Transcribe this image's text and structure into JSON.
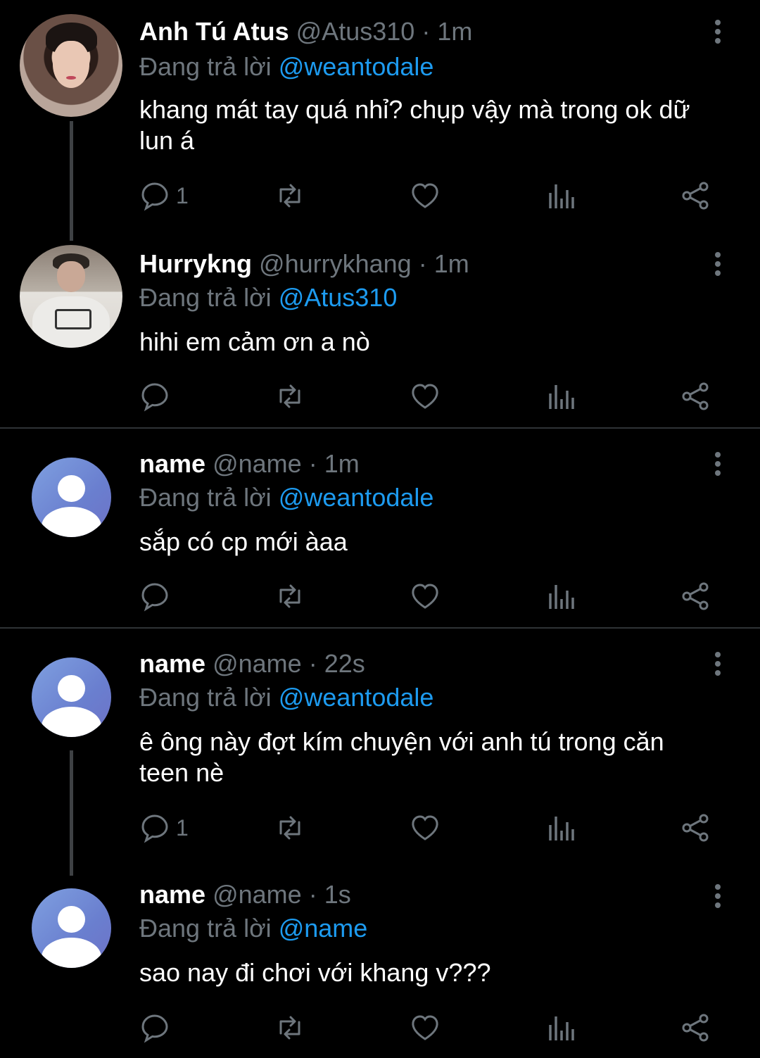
{
  "reply_prefix": "Đang trả lời",
  "tweets": [
    {
      "name": "Anh Tú Atus",
      "handle": "@Atus310",
      "separator": "·",
      "time": "1m",
      "reply_to": "@weantodale",
      "text": "khang mát tay quá nhỉ? chụp vậy mà trong ok dữ lun á",
      "reply_count": "1"
    },
    {
      "name": "Hurrykng",
      "handle": "@hurrykhang",
      "separator": "·",
      "time": "1m",
      "reply_to": "@Atus310",
      "text": "hihi em cảm ơn a nò",
      "reply_count": ""
    },
    {
      "name": "name",
      "handle": "@name",
      "separator": "·",
      "time": "1m",
      "reply_to": "@weantodale",
      "text": "sắp có cp mới àaa",
      "reply_count": ""
    },
    {
      "name": "name",
      "handle": "@name",
      "separator": "·",
      "time": "22s",
      "reply_to": "@weantodale",
      "text": "ê ông này đợt kím chuyện với anh tú trong căn teen nè",
      "reply_count": "1"
    },
    {
      "name": "name",
      "handle": "@name",
      "separator": "·",
      "time": "1s",
      "reply_to": "@name",
      "text": "sao nay đi chơi với khang v???",
      "reply_count": ""
    }
  ],
  "icons": {
    "reply": "speech-bubble-icon",
    "retweet": "retweet-icon",
    "like": "heart-icon",
    "views": "bar-chart-icon",
    "share": "share-icon",
    "more": "three-dots-vertical-icon"
  },
  "colors": {
    "background": "#000000",
    "text": "#ffffff",
    "muted": "#6e767d",
    "mention": "#1d9bf0",
    "divider": "#2f3336"
  }
}
